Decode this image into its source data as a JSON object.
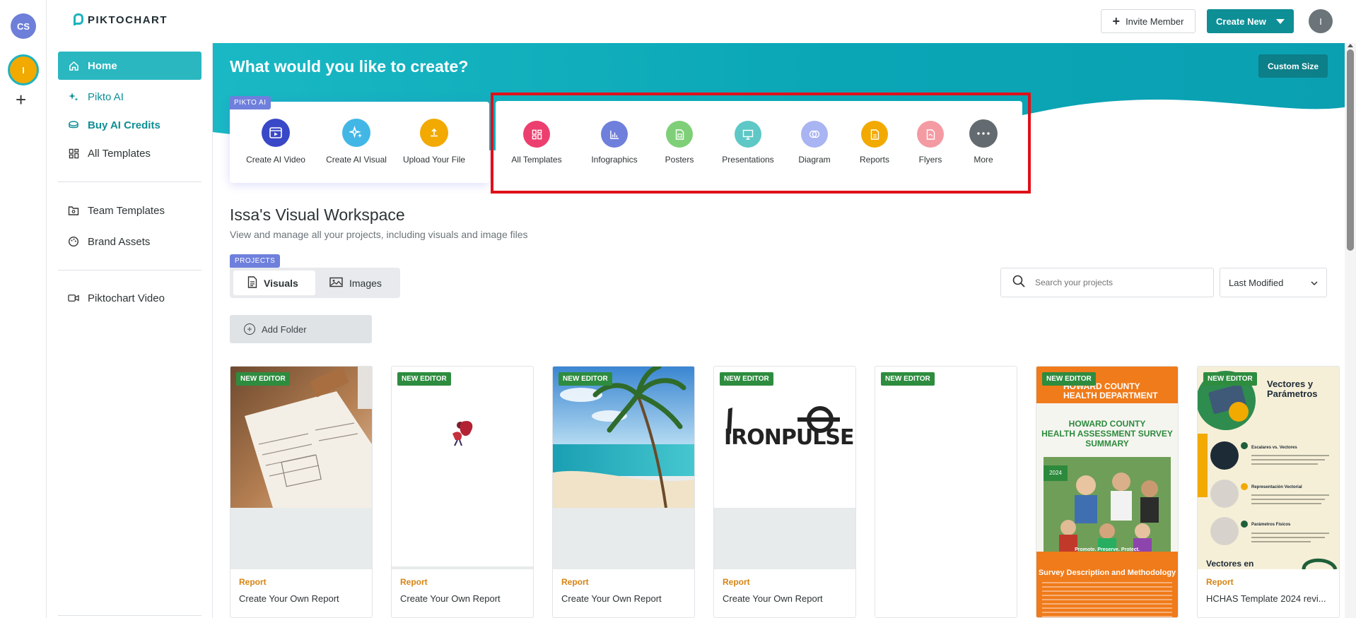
{
  "workspace_rail": {
    "avatar_top": "CS",
    "avatar_active": "I"
  },
  "header": {
    "logo_text": "PIKTOCHART",
    "invite_label": "Invite Member",
    "create_new_label": "Create New",
    "user_initial": "I"
  },
  "sidebar": {
    "home": "Home",
    "pikto_ai": "Pikto AI",
    "buy_credits": "Buy AI Credits",
    "all_templates": "All Templates",
    "team_templates": "Team Templates",
    "brand_assets": "Brand Assets",
    "piktochart_video": "Piktochart Video"
  },
  "hero": {
    "title": "What would you like to create?",
    "custom_size": "Custom Size"
  },
  "pikto_ai": {
    "badge": "PIKTO AI",
    "items": [
      {
        "label": "Create AI Video",
        "color": "#3948c7",
        "icon": "ai-video-icon"
      },
      {
        "label": "Create AI Visual",
        "color": "#42b7e6",
        "icon": "sparkle-icon"
      },
      {
        "label": "Upload Your File",
        "color": "#f2a900",
        "icon": "upload-icon"
      }
    ]
  },
  "templates": {
    "items": [
      {
        "label": "All Templates",
        "color": "#ec3f6f"
      },
      {
        "label": "Infographics",
        "color": "#6e7fdc"
      },
      {
        "label": "Posters",
        "color": "#7fcf78"
      },
      {
        "label": "Presentations",
        "color": "#5ec8c6"
      },
      {
        "label": "Diagram",
        "color": "#a9b4f2"
      },
      {
        "label": "Reports",
        "color": "#f2a900"
      },
      {
        "label": "Flyers",
        "color": "#f49aa3"
      },
      {
        "label": "More",
        "color": "#646b70"
      }
    ]
  },
  "workspace": {
    "title": "Issa's Visual Workspace",
    "subtitle": "View and manage all your projects, including visuals and image files",
    "projects_badge": "PROJECTS",
    "tab_visuals": "Visuals",
    "tab_images": "Images",
    "add_folder": "Add Folder",
    "search_placeholder": "Search your projects",
    "sort_value": "Last Modified"
  },
  "cards": [
    {
      "badge": "NEW EDITOR",
      "type": "Report",
      "title": "Create Your Own Report"
    },
    {
      "badge": "NEW EDITOR",
      "type": "Report",
      "title": "Create Your Own Report"
    },
    {
      "badge": "NEW EDITOR",
      "type": "Report",
      "title": "Create Your Own Report"
    },
    {
      "badge": "NEW EDITOR",
      "type": "Report",
      "title": "Create Your Own Report",
      "thumb_text": "IRONPULSE"
    },
    {
      "badge": "NEW EDITOR",
      "type": "",
      "title": ""
    },
    {
      "badge": "NEW EDITOR",
      "type": "",
      "title": "",
      "thumb_header": "HOWARD COUNTY\nHEALTH DEPARTMENT",
      "thumb_title": "HOWARD COUNTY\nHEALTH ASSESSMENT SURVEY\nSUMMARY",
      "thumb_year": "2024",
      "thumb_tagline": "Promote. Preserve. Protect.",
      "thumb_section": "Survey Description and Methodology"
    },
    {
      "badge": "NEW EDITOR",
      "type": "Report",
      "title": "HCHAS Template 2024 revi...",
      "thumb_title": "Vectores y\nParámetros",
      "thumb_items": [
        "Escalares vs. Vectores",
        "Representación Vectorial",
        "Parámetros Físicos"
      ],
      "thumb_footer": "Vectores en"
    }
  ]
}
